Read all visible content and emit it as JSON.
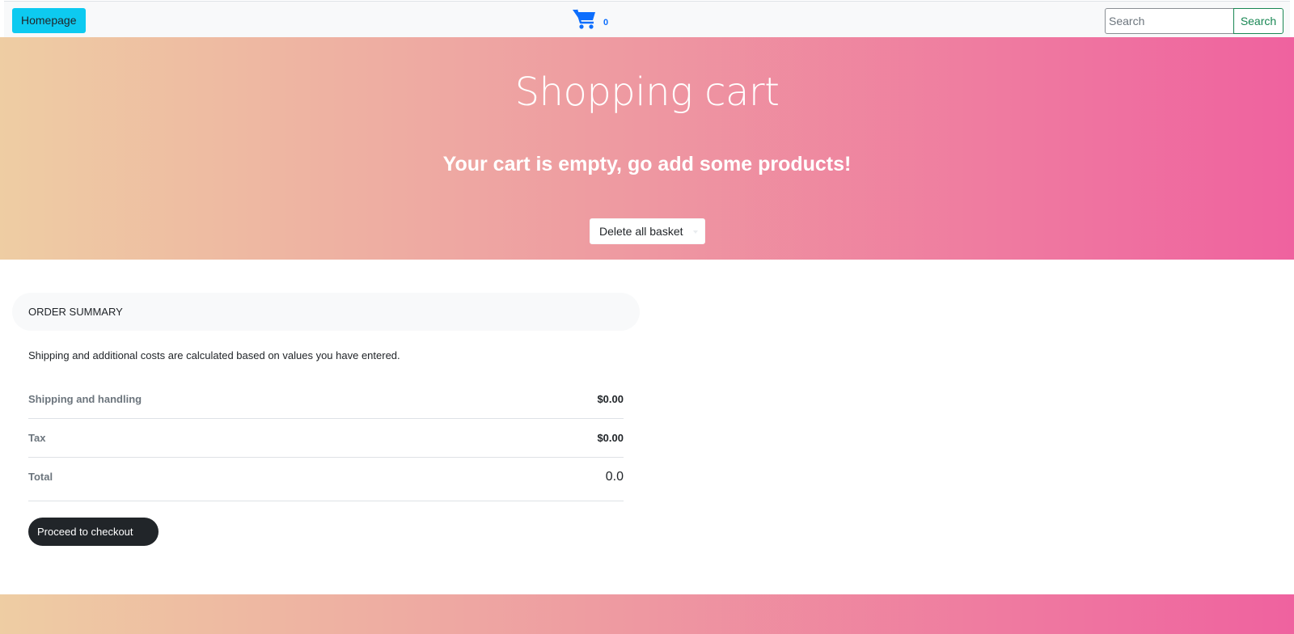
{
  "navbar": {
    "home_label": "Homepage",
    "cart_count": "0",
    "search_placeholder": "Search",
    "search_button": "Search"
  },
  "hero": {
    "title": "Shopping cart",
    "subtitle": "Your cart is empty, go add some products!",
    "delete_button": "Delete all basket"
  },
  "summary": {
    "header": "ORDER SUMMARY",
    "note": "Shipping and additional costs are calculated based on values you have entered.",
    "rows": [
      {
        "label": "Shipping and handling",
        "value": "$0.00"
      },
      {
        "label": "Tax",
        "value": "$0.00"
      },
      {
        "label": "Total",
        "value": "0.0"
      }
    ],
    "checkout_button": "Proceed to checkout"
  },
  "colors": {
    "gradient_start": "#eecda3",
    "gradient_end": "#ef629f",
    "cart_icon": "#0d6efd",
    "home_button": "#0dcaf0",
    "search_button": "#198754",
    "checkout_button": "#212529"
  },
  "icons": {
    "cart": "shopping-cart-icon"
  }
}
